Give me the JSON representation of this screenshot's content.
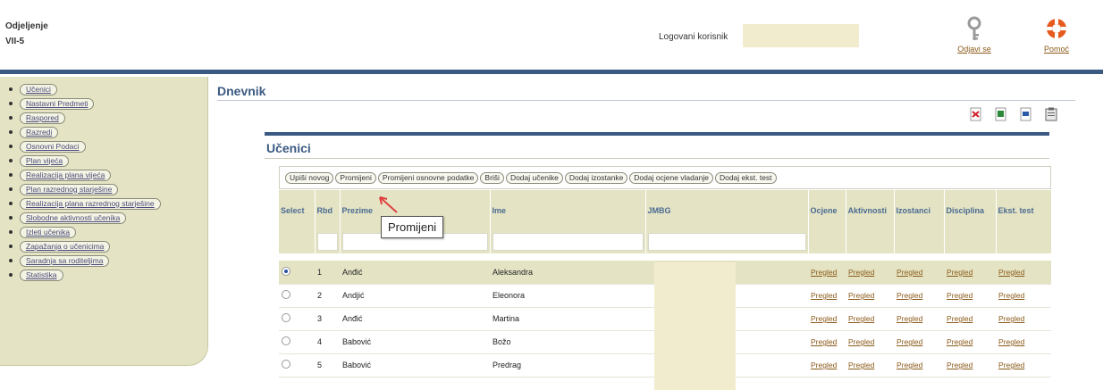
{
  "header": {
    "department_label": "Odjeljenje",
    "department_code": "VII-5",
    "logged_user_label": "Logovani korisnik",
    "logout_label": "Odjavi se",
    "help_label": "Pomoć"
  },
  "sidebar": {
    "items": [
      {
        "label": "Učenici"
      },
      {
        "label": "Nastavni Predmeti"
      },
      {
        "label": "Raspored"
      },
      {
        "label": "Razredi"
      },
      {
        "label": "Osnovni Podaci"
      },
      {
        "label": "Plan vijeća"
      },
      {
        "label": "Realizacija plana vijeća"
      },
      {
        "label": "Plan razrednog starješine"
      },
      {
        "label": "Realizacija plana razrednog starješine"
      },
      {
        "label": "Slobodne aktivnosti učenika"
      },
      {
        "label": "Izleti učenika"
      },
      {
        "label": "Zapažanja o učenicima"
      },
      {
        "label": "Saradnja sa roditeljima"
      },
      {
        "label": "Statistika"
      }
    ]
  },
  "main": {
    "title": "Dnevnik",
    "panel_title": "Učenici",
    "toolbar": {
      "buttons": [
        "Upiši novog",
        "Promijeni",
        "Promijeni osnovne podatke",
        "Briši",
        "Dodaj učenike",
        "Dodaj izostanke",
        "Dodaj ocjene vladanje",
        "Dodaj ekst. test"
      ]
    },
    "tooltip": "Promijeni",
    "table": {
      "columns": [
        "Select",
        "Rbd",
        "Prezime",
        "Ime",
        "JMBG",
        "Ocjene",
        "Aktivnosti",
        "Izostanci",
        "Disciplina",
        "Ekst. test"
      ],
      "link_label": "Pregled",
      "rows": [
        {
          "rbd": "1",
          "prezime": "Anđić",
          "ime": "Aleksandra",
          "selected": true
        },
        {
          "rbd": "2",
          "prezime": "Andjić",
          "ime": "Eleonora",
          "selected": false
        },
        {
          "rbd": "3",
          "prezime": "Anđić",
          "ime": "Martina",
          "selected": false
        },
        {
          "rbd": "4",
          "prezime": "Babović",
          "ime": "Božo",
          "selected": false
        },
        {
          "rbd": "5",
          "prezime": "Babović",
          "ime": "Predrag",
          "selected": false
        }
      ]
    }
  },
  "colors": {
    "accent": "#3b5a82",
    "sidebar_bg": "#e4e4c4",
    "link": "#8b5a1a",
    "redaction": "#f2ecce"
  }
}
